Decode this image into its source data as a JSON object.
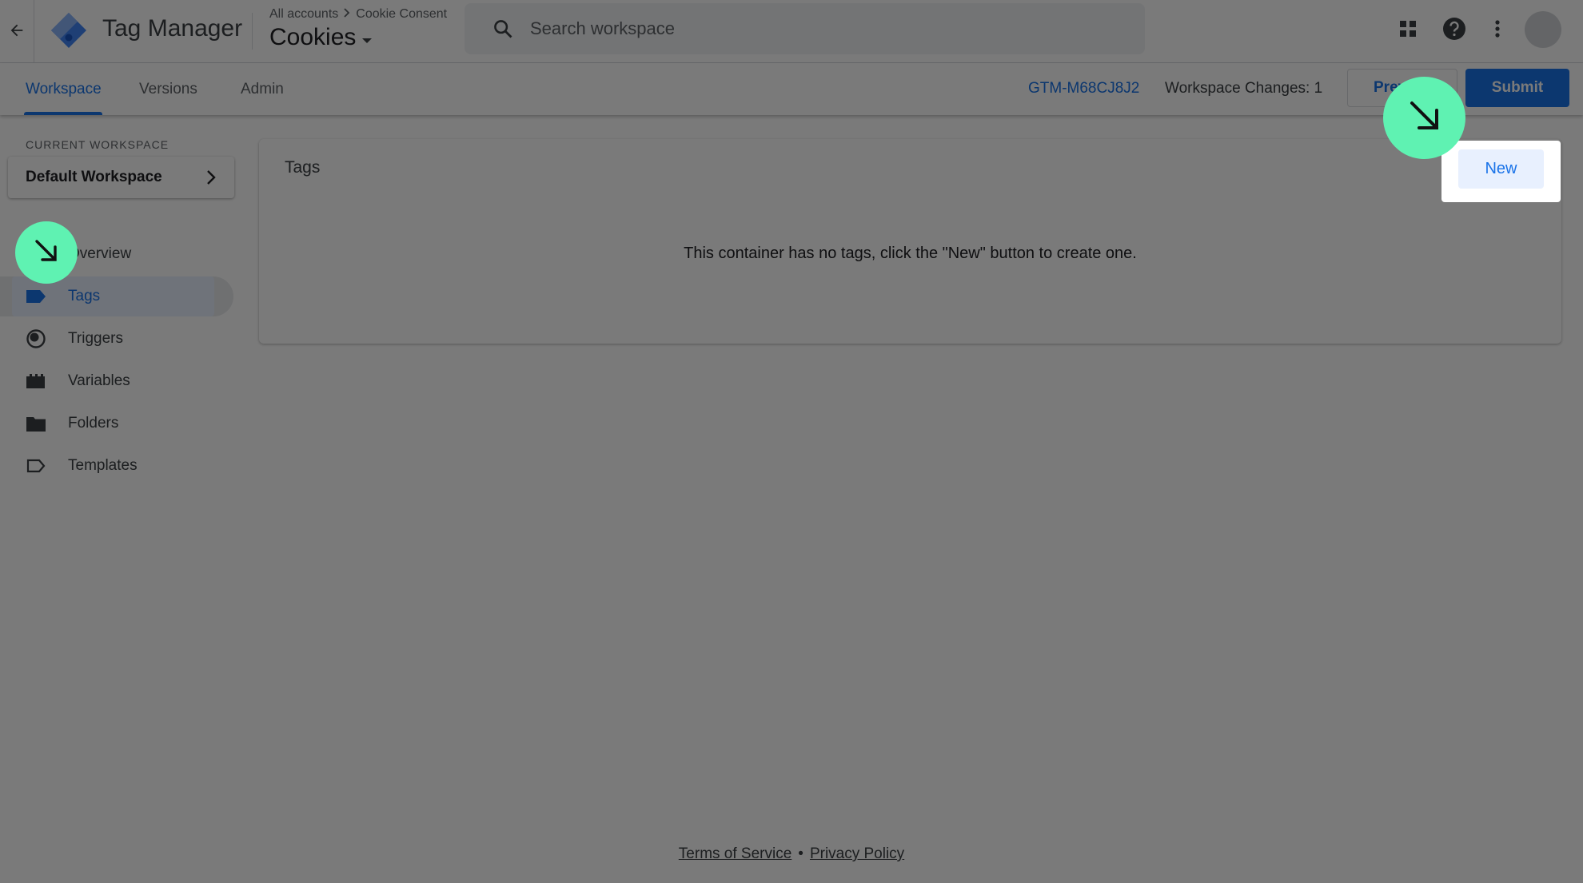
{
  "app": {
    "title": "Tag Manager",
    "breadcrumb_root": "All accounts",
    "breadcrumb_account": "Cookie Consent",
    "container_name": "Cookies"
  },
  "search": {
    "placeholder": "Search workspace"
  },
  "tabs": [
    {
      "label": "Workspace",
      "active": true
    },
    {
      "label": "Versions",
      "active": false
    },
    {
      "label": "Admin",
      "active": false
    }
  ],
  "header_right": {
    "container_id": "GTM-M68CJ8J2",
    "workspace_changes": "Workspace Changes: 1",
    "preview_label": "Preview",
    "submit_label": "Submit"
  },
  "sidebar": {
    "current_workspace_label": "CURRENT WORKSPACE",
    "workspace_name": "Default Workspace",
    "items": [
      {
        "label": "Overview",
        "icon": "overview-icon"
      },
      {
        "label": "Tags",
        "icon": "tag-icon",
        "selected": true
      },
      {
        "label": "Triggers",
        "icon": "trigger-icon"
      },
      {
        "label": "Variables",
        "icon": "variables-icon"
      },
      {
        "label": "Folders",
        "icon": "folder-icon"
      },
      {
        "label": "Templates",
        "icon": "template-icon"
      }
    ]
  },
  "main": {
    "card_title": "Tags",
    "new_button": "New",
    "empty_message": "This container has no tags, click the \"New\" button to create one."
  },
  "footer": {
    "terms": "Terms of Service",
    "separator": "•",
    "privacy": "Privacy Policy"
  },
  "colors": {
    "accent": "#1a73e8",
    "guide_bubble": "#5ff2b2",
    "overlay": "rgba(0,0,0,0.52)"
  }
}
